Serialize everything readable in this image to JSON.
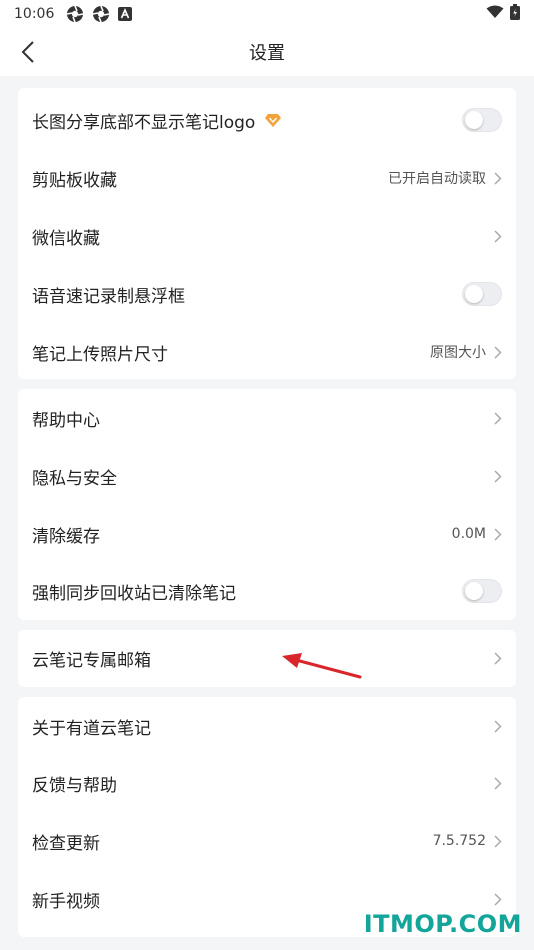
{
  "status_bar": {
    "time": "10:06",
    "left_icons": [
      "aperture-icon",
      "aperture-icon",
      "a-letter-icon"
    ],
    "right_icons": [
      "wifi-icon",
      "battery-icon"
    ]
  },
  "nav": {
    "title": "设置",
    "back_icon": "chevron-left-icon"
  },
  "groups": [
    {
      "items": [
        {
          "label": "长图分享底部不显示笔记logo",
          "control": "toggle",
          "on": false,
          "badge": "vip-diamond-icon"
        },
        {
          "label": "剪贴板收藏",
          "control": "chevron",
          "value": "已开启自动读取"
        },
        {
          "label": "微信收藏",
          "control": "chevron"
        },
        {
          "label": "语音速记录制悬浮框",
          "control": "toggle",
          "on": false
        },
        {
          "label": "笔记上传照片尺寸",
          "control": "chevron",
          "value": "原图大小"
        }
      ]
    },
    {
      "items": [
        {
          "label": "帮助中心",
          "control": "chevron"
        },
        {
          "label": "隐私与安全",
          "control": "chevron"
        },
        {
          "label": "清除缓存",
          "control": "chevron",
          "value": "0.0M"
        },
        {
          "label": "强制同步回收站已清除笔记",
          "control": "toggle",
          "on": false
        }
      ]
    },
    {
      "items": [
        {
          "label": "云笔记专属邮箱",
          "control": "chevron"
        }
      ]
    },
    {
      "items": [
        {
          "label": "关于有道云笔记",
          "control": "chevron"
        },
        {
          "label": "反馈与帮助",
          "control": "chevron"
        },
        {
          "label": "检查更新",
          "control": "chevron",
          "value": "7.5.752"
        },
        {
          "label": "新手视频",
          "control": "chevron"
        }
      ]
    }
  ],
  "colors": {
    "background": "#f4f5f7",
    "card": "#ffffff",
    "vip_badge": "#f5a13a",
    "annotation_arrow": "#d9262b",
    "watermark": "#13a49a"
  },
  "watermark": "ITMOP.COM"
}
